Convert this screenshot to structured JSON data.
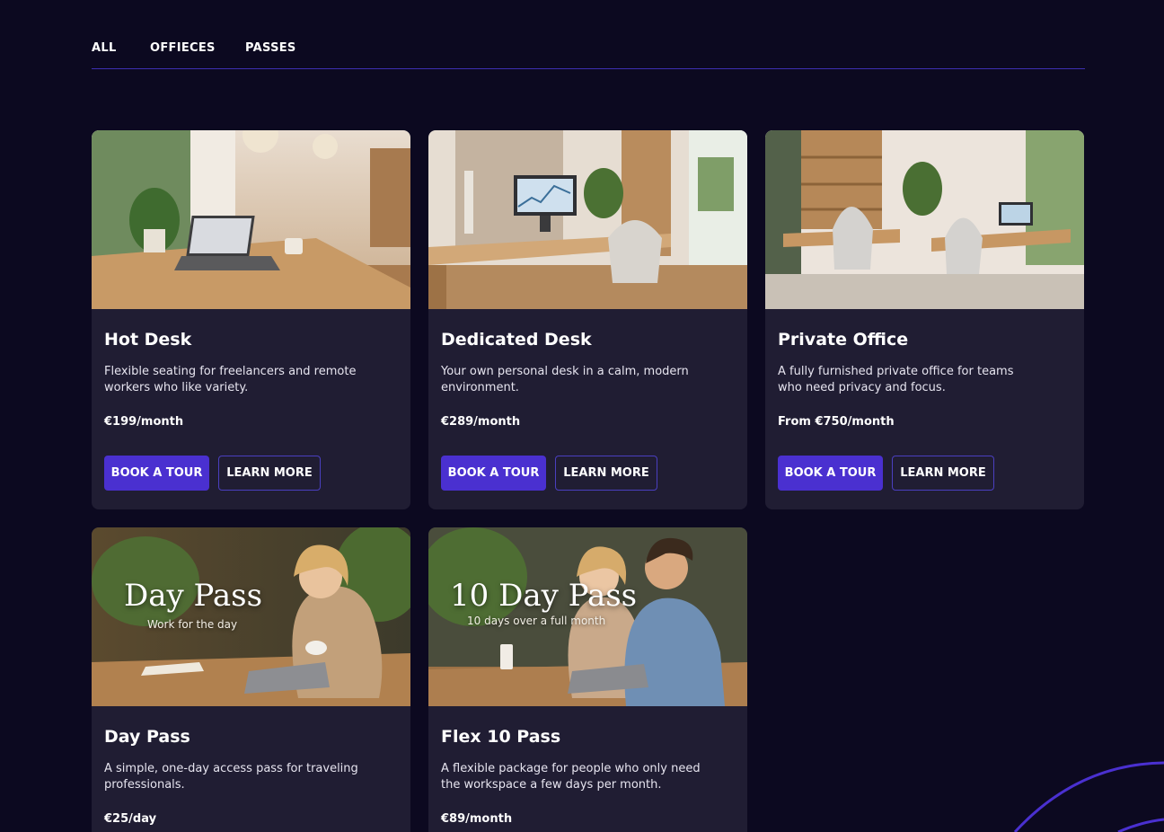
{
  "tabs": [
    {
      "label": "ALL"
    },
    {
      "label": "OFFIECES"
    },
    {
      "label": "PASSES"
    }
  ],
  "colors": {
    "background": "#0c0920",
    "card": "#201d33",
    "accent": "#4a30d0",
    "divider": "#3d2fb0"
  },
  "cards": [
    {
      "title": "Hot Desk",
      "description": "Flexible seating for freelancers and remote workers who like variety.",
      "price": "€199/month",
      "primary_label": "BOOK A TOUR",
      "secondary_label": "LEARN MORE"
    },
    {
      "title": "Dedicated Desk",
      "description": "Your own personal desk in a calm, modern environment.",
      "price": "€289/month",
      "primary_label": "BOOK A TOUR",
      "secondary_label": "LEARN MORE"
    },
    {
      "title": "Private Office",
      "description": "A fully furnished private office for teams who need privacy and focus.",
      "price": "From €750/month",
      "primary_label": "BOOK A TOUR",
      "secondary_label": "LEARN MORE"
    },
    {
      "title": "Day Pass",
      "description": "A simple, one-day access pass for traveling professionals.",
      "price": "€25/day",
      "image_title": "Day Pass",
      "image_subtitle": "Work for the day"
    },
    {
      "title": "Flex 10 Pass",
      "description": "A flexible package for people who only need the workspace a few days per month.",
      "price": "€89/month",
      "image_title": "10 Day Pass",
      "image_subtitle": "10 days over a full month"
    }
  ]
}
